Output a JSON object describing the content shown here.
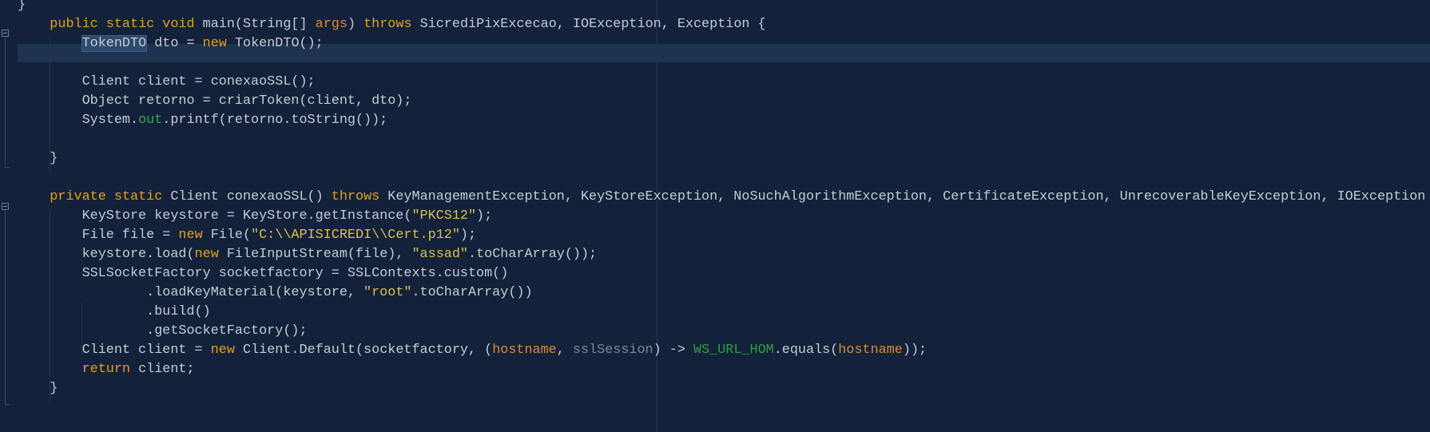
{
  "editor": {
    "background": "#13213a",
    "current_line_background": "#1d3350",
    "colors": {
      "text": "#c7ccd4",
      "keyword": "#e3a21a",
      "string": "#d9c24a",
      "parameter": "#e08a2a",
      "static_field": "#3aa74f",
      "constant": "#2ea043",
      "unused": "#7d8696"
    },
    "fold_markers": [
      "fold-main",
      "fold-conexaoSSL"
    ],
    "highlighted_identifier": "TokenDTO",
    "lines": [
      {
        "tokens": [
          {
            "text": "}",
            "kind": "plain"
          }
        ]
      },
      {
        "tokens": [
          {
            "text": "    ",
            "kind": "plain"
          },
          {
            "text": "public static void ",
            "kind": "kw"
          },
          {
            "text": "main(String[] ",
            "kind": "plain"
          },
          {
            "text": "args",
            "kind": "param"
          },
          {
            "text": ") ",
            "kind": "plain"
          },
          {
            "text": "throws ",
            "kind": "kw"
          },
          {
            "text": "SicrediPixExcecao, IOException, Exception {",
            "kind": "plain"
          }
        ]
      },
      {
        "current": true,
        "tokens": [
          {
            "text": "        ",
            "kind": "plain"
          },
          {
            "text": "TokenDTO",
            "kind": "ident-hl"
          },
          {
            "text": " dto = ",
            "kind": "plain"
          },
          {
            "text": "new ",
            "kind": "kw"
          },
          {
            "text": "TokenDTO();",
            "kind": "plain"
          }
        ]
      },
      {
        "tokens": []
      },
      {
        "tokens": [
          {
            "text": "        Client client = conexaoSSL();",
            "kind": "plain"
          }
        ]
      },
      {
        "tokens": [
          {
            "text": "        Object retorno = criarToken(client, dto);",
            "kind": "plain"
          }
        ]
      },
      {
        "tokens": [
          {
            "text": "        System.",
            "kind": "plain"
          },
          {
            "text": "out",
            "kind": "field"
          },
          {
            "text": ".printf(retorno.toString());",
            "kind": "plain"
          }
        ]
      },
      {
        "tokens": []
      },
      {
        "tokens": [
          {
            "text": "    }",
            "kind": "plain"
          }
        ]
      },
      {
        "tokens": []
      },
      {
        "tokens": [
          {
            "text": "    ",
            "kind": "plain"
          },
          {
            "text": "private static ",
            "kind": "kw"
          },
          {
            "text": "Client conexaoSSL() ",
            "kind": "plain"
          },
          {
            "text": "throws ",
            "kind": "kw"
          },
          {
            "text": "KeyManagementException, KeyStoreException, NoSuchAlgorithmException, CertificateException, UnrecoverableKeyException, IOException {",
            "kind": "plain"
          }
        ]
      },
      {
        "tokens": [
          {
            "text": "        KeyStore keystore = KeyStore.getInstance(",
            "kind": "plain"
          },
          {
            "text": "\"PKCS12\"",
            "kind": "str"
          },
          {
            "text": ");",
            "kind": "plain"
          }
        ]
      },
      {
        "tokens": [
          {
            "text": "        File file = ",
            "kind": "plain"
          },
          {
            "text": "new ",
            "kind": "kw"
          },
          {
            "text": "File(",
            "kind": "plain"
          },
          {
            "text": "\"C:\\\\APISICREDI\\\\Cert.p12\"",
            "kind": "str"
          },
          {
            "text": ");",
            "kind": "plain"
          }
        ]
      },
      {
        "tokens": [
          {
            "text": "        keystore.load(",
            "kind": "plain"
          },
          {
            "text": "new ",
            "kind": "kw"
          },
          {
            "text": "FileInputStream(file), ",
            "kind": "plain"
          },
          {
            "text": "\"assad\"",
            "kind": "str"
          },
          {
            "text": ".toCharArray());",
            "kind": "plain"
          }
        ]
      },
      {
        "tokens": [
          {
            "text": "        SSLSocketFactory socketfactory = SSLContexts.custom()",
            "kind": "plain"
          }
        ]
      },
      {
        "tokens": [
          {
            "text": "                .loadKeyMaterial(keystore, ",
            "kind": "plain"
          },
          {
            "text": "\"root\"",
            "kind": "str"
          },
          {
            "text": ".toCharArray())",
            "kind": "plain"
          }
        ]
      },
      {
        "tokens": [
          {
            "text": "                .build()",
            "kind": "plain"
          }
        ]
      },
      {
        "tokens": [
          {
            "text": "                .getSocketFactory();",
            "kind": "plain"
          }
        ]
      },
      {
        "tokens": [
          {
            "text": "        Client client = ",
            "kind": "plain"
          },
          {
            "text": "new ",
            "kind": "kw"
          },
          {
            "text": "Client.Default(socketfactory, (",
            "kind": "plain"
          },
          {
            "text": "hostname",
            "kind": "param"
          },
          {
            "text": ", ",
            "kind": "plain"
          },
          {
            "text": "sslSession",
            "kind": "unused"
          },
          {
            "text": ") -> ",
            "kind": "plain"
          },
          {
            "text": "WS_URL_HOM",
            "kind": "const"
          },
          {
            "text": ".equals(",
            "kind": "plain"
          },
          {
            "text": "hostname",
            "kind": "param"
          },
          {
            "text": "));",
            "kind": "plain"
          }
        ]
      },
      {
        "tokens": [
          {
            "text": "        ",
            "kind": "plain"
          },
          {
            "text": "return ",
            "kind": "kw"
          },
          {
            "text": "client;",
            "kind": "plain"
          }
        ]
      },
      {
        "tokens": [
          {
            "text": "    }",
            "kind": "plain"
          }
        ]
      }
    ]
  }
}
